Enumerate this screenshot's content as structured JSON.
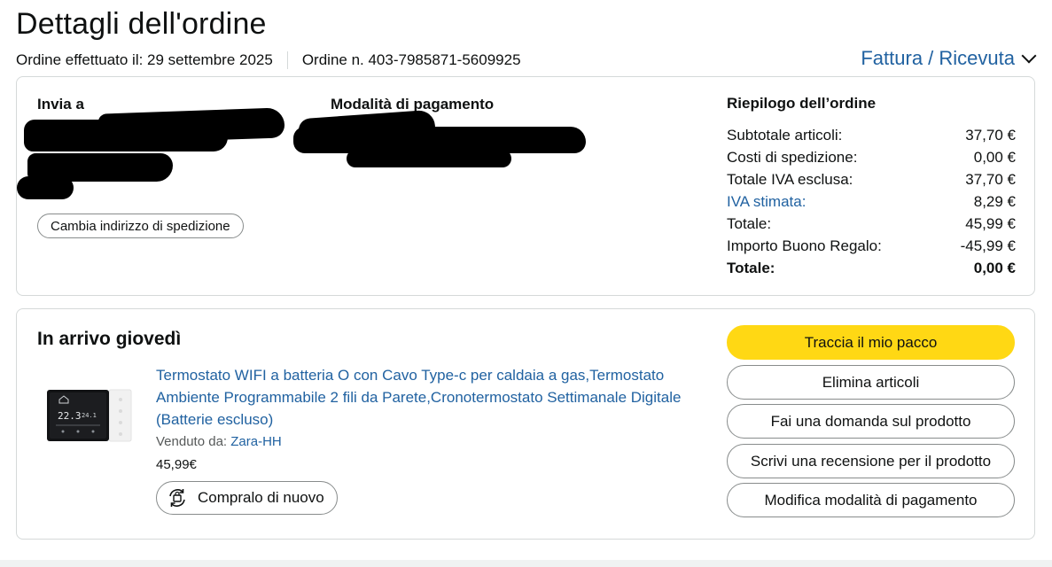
{
  "page": {
    "title": "Dettagli dell'ordine",
    "order_date": "Ordine effettuato il: 29 settembre 2025",
    "order_number": "Ordine n. 403-7985871-5609925",
    "invoice_label": "Fattura / Ricevuta"
  },
  "shipping": {
    "heading": "Invia a",
    "change_address": "Cambia indirizzo di spedizione"
  },
  "payment": {
    "heading": "Modalità di pagamento"
  },
  "summary": {
    "heading": "Riepilogo dell’ordine",
    "rows": [
      {
        "label": "Subtotale articoli:",
        "value": "37,70 €"
      },
      {
        "label": "Costi di spedizione:",
        "value": "0,00 €"
      },
      {
        "label": "Totale IVA esclusa:",
        "value": "37,70 €"
      },
      {
        "label": "IVA stimata:",
        "value": "8,29 €"
      },
      {
        "label": "Totale:",
        "value": "45,99 €"
      },
      {
        "label": "Importo Buono Regalo:",
        "value": "-45,99 €"
      },
      {
        "label": "Totale:",
        "value": "0,00 €"
      }
    ]
  },
  "shipment": {
    "status": "In arrivo giovedì",
    "product_title": "Termostato WIFI a batteria O con Cavo Type-c per caldaia a gas,Termostato Ambiente Programmabile 2 fili da Parete,Cronotermostato Settimanale Digitale (Batterie escluso)",
    "sold_by_label": "Venduto da:",
    "seller": "Zara-HH",
    "price": "45,99€",
    "buy_again": "Compralo di nuovo",
    "thumb_temp_main": "22.3",
    "thumb_temp_set": "24.1"
  },
  "actions": {
    "track": "Traccia il mio pacco",
    "remove": "Elimina articoli",
    "ask": "Fai una domanda sul prodotto",
    "review": "Scrivi una recensione per il prodotto",
    "change_payment": "Modifica modalità di pagamento"
  },
  "colors": {
    "link": "#2162a1",
    "primary_button": "#ffd814",
    "border": "#d5d9d9"
  }
}
